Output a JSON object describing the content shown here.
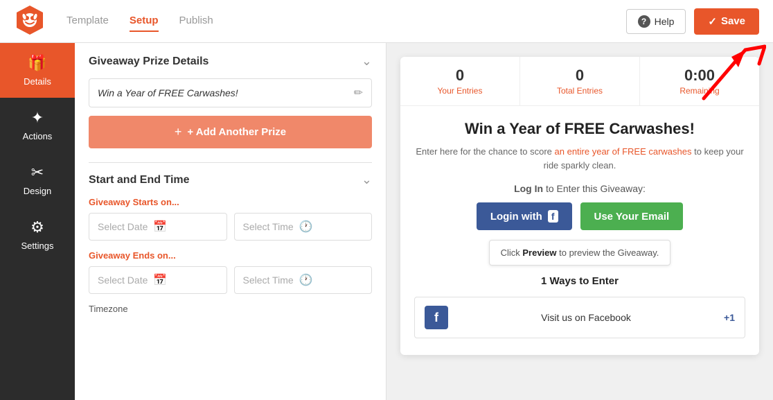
{
  "header": {
    "tabs": [
      {
        "id": "template",
        "label": "Template",
        "active": false
      },
      {
        "id": "setup",
        "label": "Setup",
        "active": true
      },
      {
        "id": "publish",
        "label": "Publish",
        "active": false
      }
    ],
    "help_label": "Help",
    "save_label": "Save"
  },
  "sidebar": {
    "items": [
      {
        "id": "details",
        "label": "Details",
        "icon": "🎁",
        "active": true
      },
      {
        "id": "actions",
        "label": "Actions",
        "icon": "✦",
        "active": false
      },
      {
        "id": "design",
        "label": "Design",
        "icon": "✂",
        "active": false
      },
      {
        "id": "settings",
        "label": "Settings",
        "icon": "⚙",
        "active": false
      }
    ]
  },
  "left_panel": {
    "sections": {
      "prize_details": {
        "title": "Giveaway Prize Details",
        "prize_text": "Win a Year of FREE Carwashes!",
        "add_prize_label": "+ Add Another Prize"
      },
      "start_end_time": {
        "title": "Start and End Time",
        "starts_label": "Giveaway Starts on...",
        "ends_label": "Giveaway Ends on...",
        "select_date_placeholder": "Select Date",
        "select_time_placeholder": "Select Time",
        "timezone_label": "Timezone"
      }
    }
  },
  "preview": {
    "stats": [
      {
        "value": "0",
        "label": "Your Entries"
      },
      {
        "value": "0",
        "label": "Total Entries"
      },
      {
        "value": "0:00",
        "label": "Remaining"
      }
    ],
    "title": "Win a Year of FREE Carwashes!",
    "description_parts": [
      "Enter here for the chance to score ",
      "an entire year of FREE carwashes",
      " to keep your ride sparkly clean."
    ],
    "login_prompt": "Log In to Enter this Giveaway:",
    "login_fb_label": "Login with",
    "login_email_label": "Use Your Email",
    "tooltip_text": "Click Preview to preview the Giveaway.",
    "ways_to_enter": "1 Ways to Enter",
    "fb_visit_text": "Visit us on Facebook",
    "fb_plus_one": "+1"
  }
}
